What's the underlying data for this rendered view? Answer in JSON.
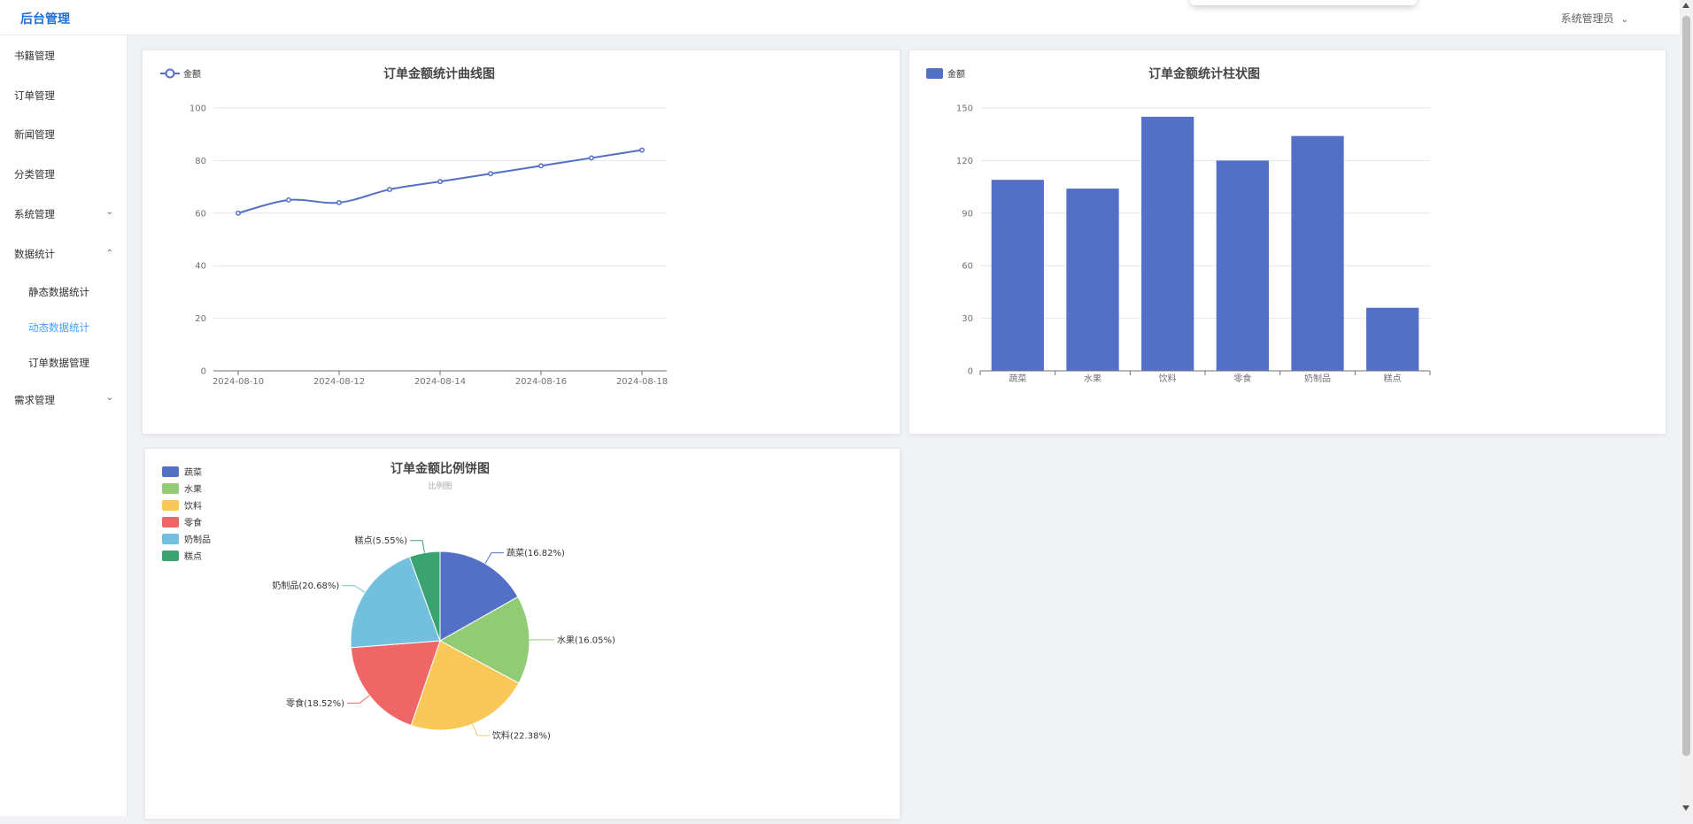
{
  "header": {
    "brand": "后台管理",
    "user": "系统管理员"
  },
  "sidebar": {
    "items": [
      {
        "label": "书籍管理"
      },
      {
        "label": "订单管理"
      },
      {
        "label": "新闻管理"
      },
      {
        "label": "分类管理"
      },
      {
        "label": "系统管理"
      },
      {
        "label": "数据统计"
      },
      {
        "label": "需求管理"
      }
    ],
    "subitems": [
      {
        "label": "静态数据统计"
      },
      {
        "label": "动态数据统计"
      },
      {
        "label": "订单数据管理"
      }
    ]
  },
  "colors": {
    "accent": "#409eff",
    "brand": "#1e6fd9",
    "series": "#5470c6"
  },
  "chart_data": [
    {
      "type": "line",
      "title": "订单金额统计曲线图",
      "legend": [
        "金额"
      ],
      "legend_position": "top-left",
      "x": [
        "2024-08-10",
        "2024-08-11",
        "2024-08-12",
        "2024-08-13",
        "2024-08-14",
        "2024-08-15",
        "2024-08-16",
        "2024-08-17",
        "2024-08-18"
      ],
      "x_ticks": [
        "2024-08-10",
        "2024-08-12",
        "2024-08-14",
        "2024-08-16",
        "2024-08-18"
      ],
      "series": [
        {
          "name": "金额",
          "values": [
            60,
            65,
            64,
            69,
            72,
            75,
            78,
            81,
            84
          ]
        }
      ],
      "ylim": [
        0,
        100
      ],
      "y_ticks": [
        0,
        20,
        40,
        60,
        80,
        100
      ],
      "grid": true
    },
    {
      "type": "bar",
      "title": "订单金额统计柱状图",
      "legend": [
        "金额"
      ],
      "legend_position": "top-left",
      "categories": [
        "蔬菜",
        "水果",
        "饮料",
        "零食",
        "奶制品",
        "糕点"
      ],
      "series": [
        {
          "name": "金额",
          "values": [
            109,
            104,
            145,
            120,
            134,
            36
          ]
        }
      ],
      "ylim": [
        0,
        150
      ],
      "y_ticks": [
        0,
        30,
        60,
        90,
        120,
        150
      ],
      "grid": true
    },
    {
      "type": "pie",
      "title": "订单金额比例饼图",
      "subtitle": "比例图",
      "legend_position": "top-left",
      "slices": [
        {
          "name": "蔬菜",
          "value": 16.82,
          "label": "蔬菜(16.82%)",
          "color": "#5470c6"
        },
        {
          "name": "水果",
          "value": 16.05,
          "label": "水果(16.05%)",
          "color": "#91cc75"
        },
        {
          "name": "饮料",
          "value": 22.38,
          "label": "饮料(22.38%)",
          "color": "#fac858"
        },
        {
          "name": "零食",
          "value": 18.52,
          "label": "零食(18.52%)",
          "color": "#ee6666"
        },
        {
          "name": "奶制品",
          "value": 20.68,
          "label": "奶制品(20.68%)",
          "color": "#73c0de"
        },
        {
          "name": "糕点",
          "value": 5.55,
          "label": "糕点(5.55%)",
          "color": "#3ba272"
        }
      ]
    }
  ]
}
